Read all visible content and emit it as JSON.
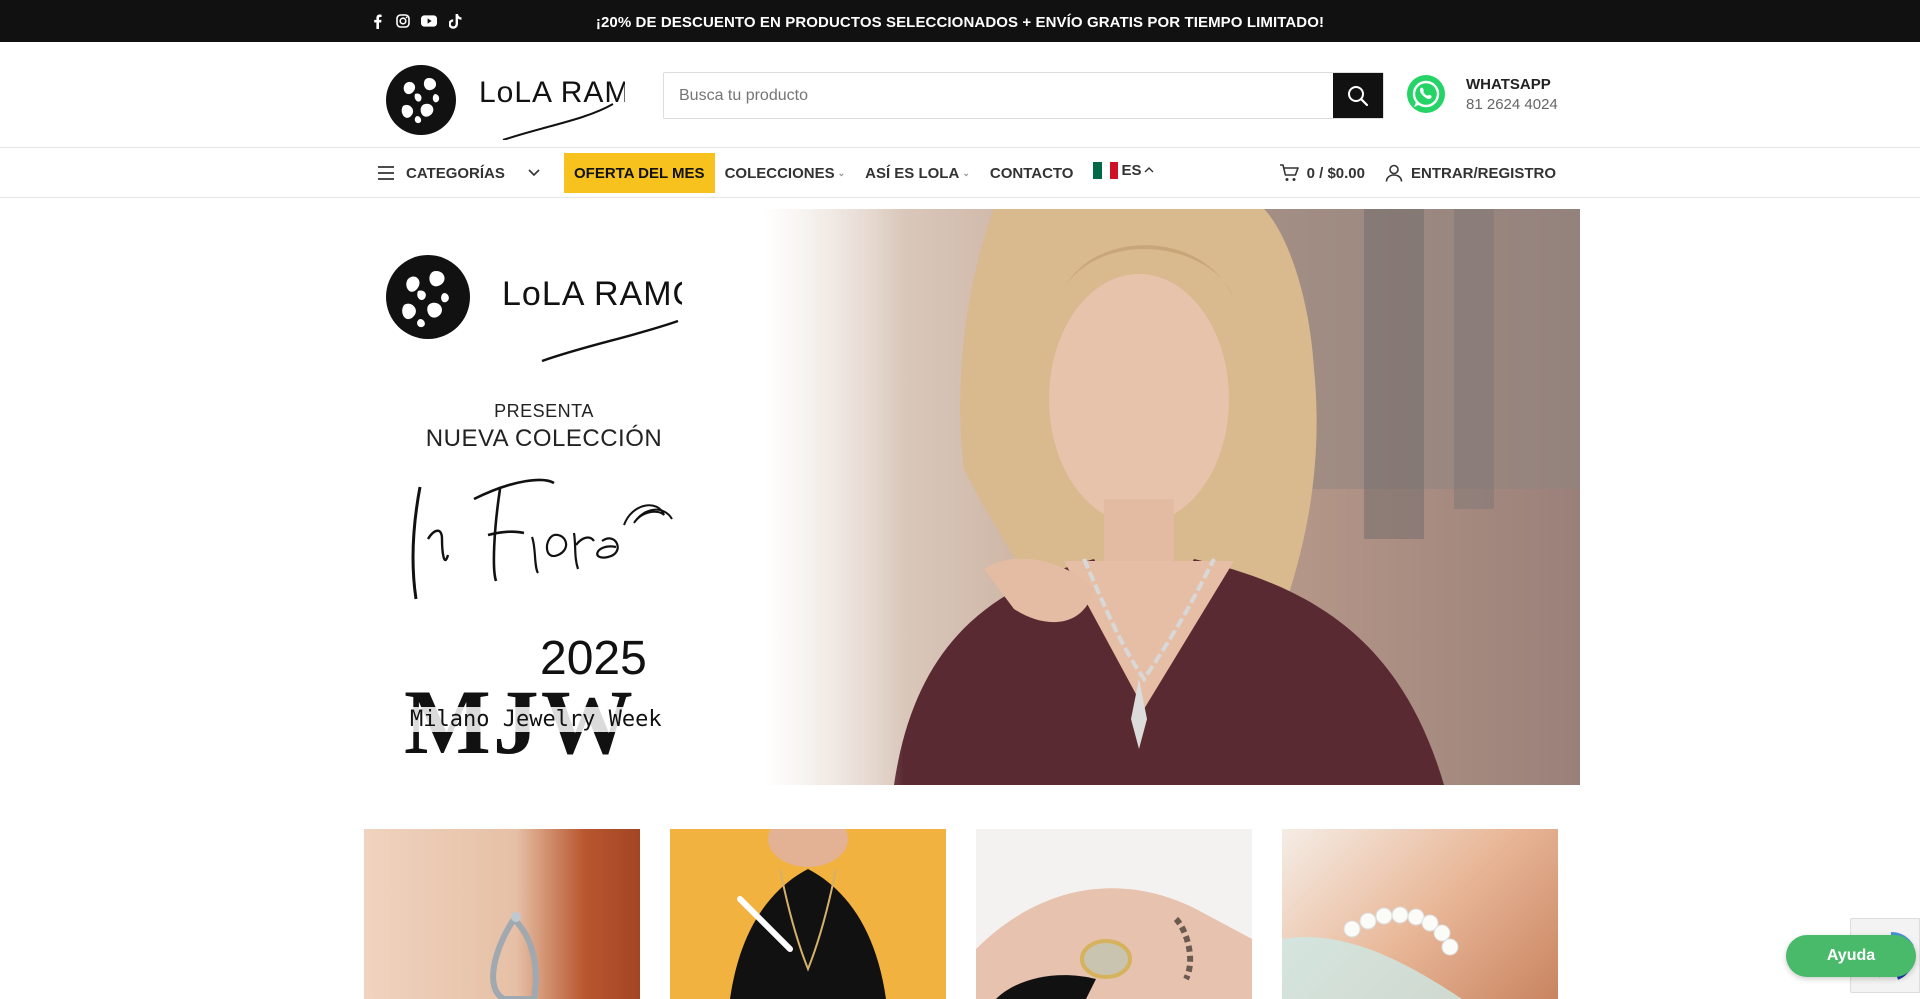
{
  "topbar": {
    "promo": "¡20% DE DESCUENTO EN PRODUCTOS SELECCIONADOS + ENVÍO GRATIS POR TIEMPO LIMITADO!",
    "socials": [
      "facebook-icon",
      "instagram-icon",
      "youtube-icon",
      "tiktok-icon"
    ]
  },
  "header": {
    "brand": "LOLA RAMOS",
    "search_placeholder": "Busca tu producto",
    "whatsapp_title": "WHATSAPP",
    "whatsapp_number": "81 2624 4024"
  },
  "nav": {
    "categories": "CATEGORÍAS",
    "links": [
      "OFERTA DEL MES",
      "COLECCIONES",
      "ASÍ ES LOLA",
      "CONTACTO"
    ],
    "lang": "ES",
    "cart": "0 / $0.00",
    "account": "ENTRAR/REGISTRO"
  },
  "hero": {
    "presenta": "PRESENTA",
    "nueva": "NUEVA COLECCIÓN",
    "collection": "In Fiore",
    "year": "2025",
    "mjw_letters": "MJW",
    "mjw_sub": "Milano Jewelry Week"
  },
  "help": {
    "label": "Ayuda"
  },
  "colors": {
    "accent": "#f7c21d",
    "dark": "#111111",
    "help": "#49b96a",
    "whatsapp": "#25d366"
  }
}
